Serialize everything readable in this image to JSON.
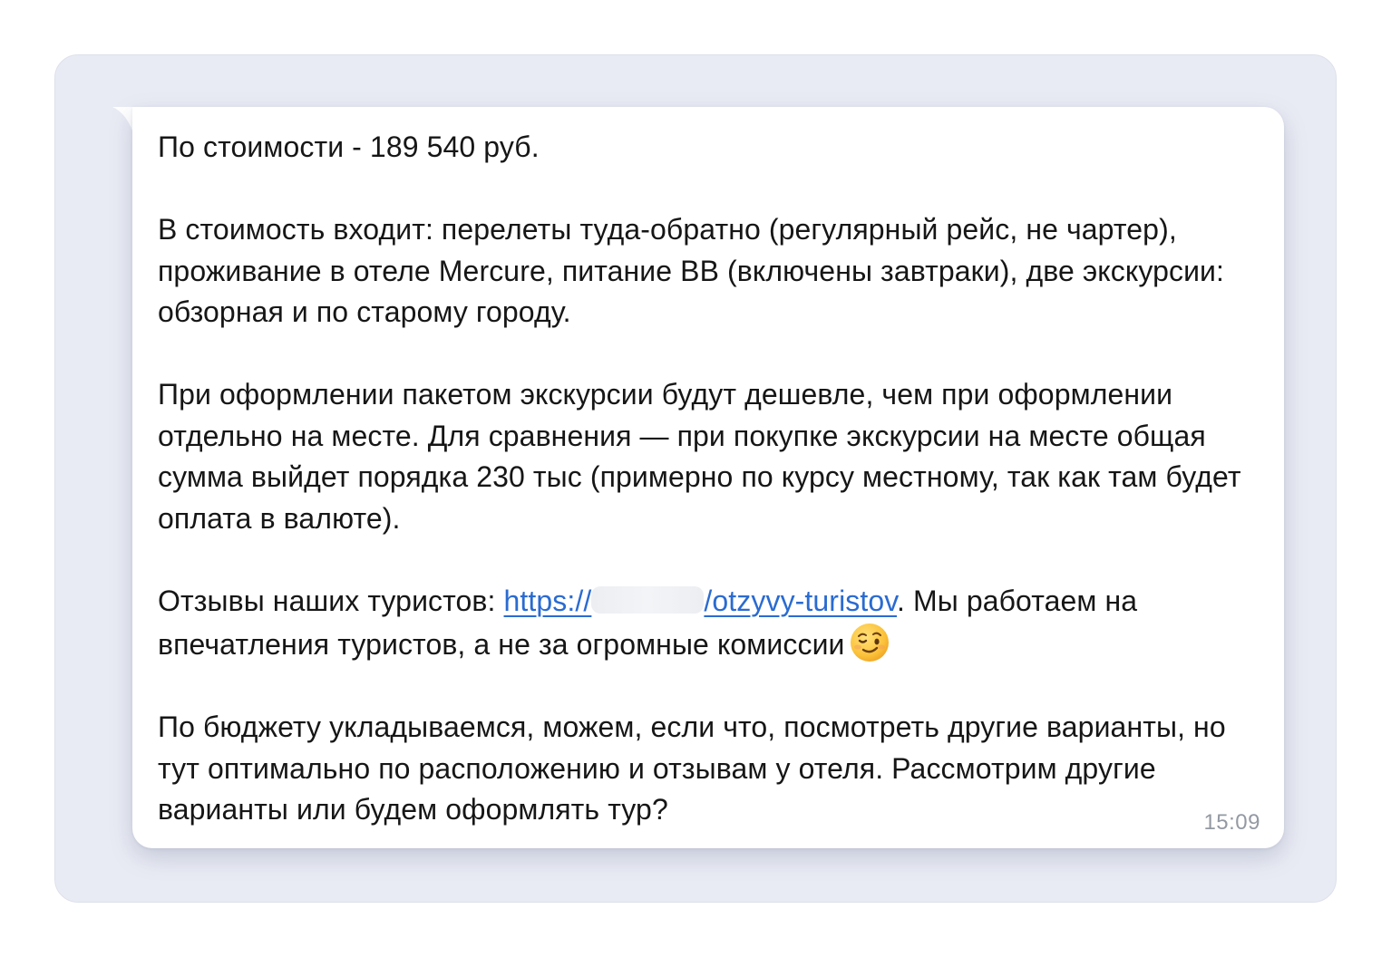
{
  "message": {
    "p1": "По стоимости - 189 540 руб.",
    "p2": "В стоимость входит: перелеты туда-обратно (регулярный рейс, не чартер), проживание в отеле Mercure, питание BB (включены завтраки), две экскурсии: обзорная и по старому городу.",
    "p3": "При оформлении пакетом экскурсии будут дешевле, чем при оформлении отдельно на месте. Для сравнения — при покупке экскурсии на месте общая сумма выйдет порядка 230 тыс (примерно по курсу местному, так как там будет оплата в валюте).",
    "p4_before_link": "Отзывы наших туристов: ",
    "link_prefix": "https://",
    "link_suffix": "/otzyvy-turistov",
    "p4_after_link": ". Мы работаем на впечатления туристов, а не за огромные комиссии",
    "emoji_icon": "winking-smile-emoji",
    "p5": "По бюджету укладываемся, можем, если что, посмотреть другие варианты, но тут оптимально по расположению и отзывам у отеля. Рассмотрим другие варианты или будем оформлять тур?",
    "time": "15:09"
  },
  "colors": {
    "chat_background": "#e9ebf4",
    "bubble": "#ffffff",
    "text": "#161616",
    "link": "#2a6bd1",
    "time": "#9399a3"
  }
}
